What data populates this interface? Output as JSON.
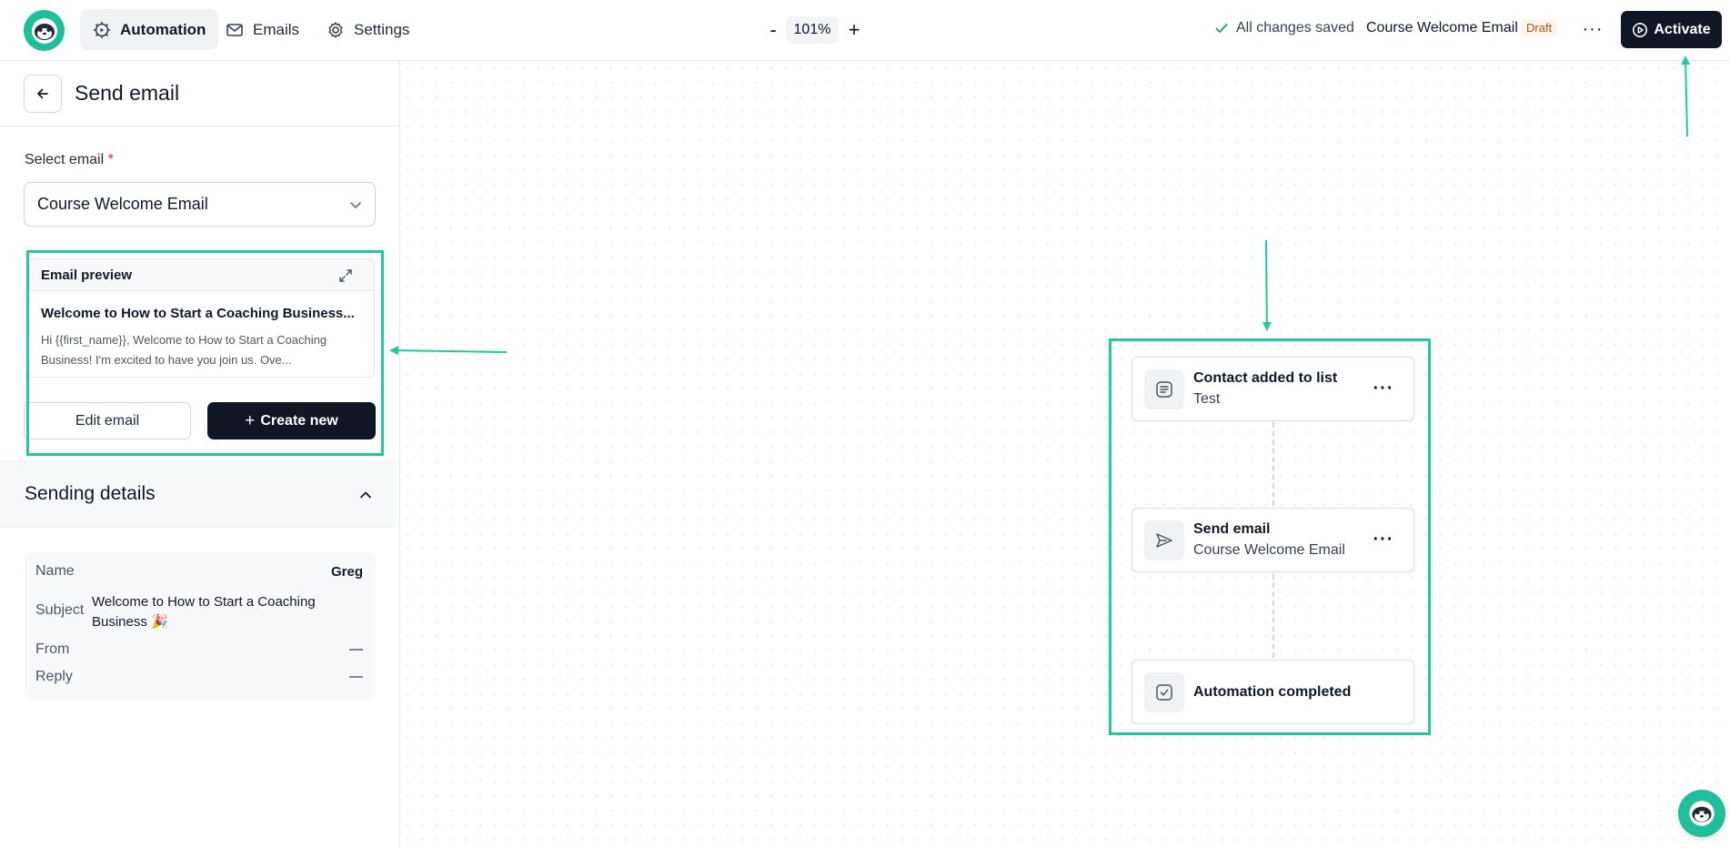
{
  "topbar": {
    "nav": [
      {
        "label": "Automation",
        "icon": "gear-play-icon",
        "active": true
      },
      {
        "label": "Emails",
        "icon": "mail-icon",
        "active": false
      },
      {
        "label": "Settings",
        "icon": "gear-icon",
        "active": false
      }
    ],
    "zoom": {
      "minus": "-",
      "value": "101%",
      "plus": "+"
    },
    "saved_status": "All changes saved",
    "document_title": "Course Welcome Email",
    "status_badge": "Draft",
    "more": "···",
    "activate_label": "Activate"
  },
  "panel": {
    "title": "Send email",
    "select_label": "Select email",
    "required_mark": "*",
    "selected_email": "Course Welcome Email",
    "preview": {
      "heading": "Email preview",
      "subject": "Welcome to How to Start a Coaching Business...",
      "body": "Hi {{first_name}}, Welcome to How to Start a Coaching Business! I'm excited to have you join us. Ove..."
    },
    "edit_label": "Edit email",
    "create_label": "Create new",
    "create_plus": "+",
    "sending": {
      "title": "Sending details",
      "details": [
        {
          "label": "Name",
          "value": "Greg"
        },
        {
          "label": "Subject",
          "value": "Welcome to How to Start a Coaching Business 🎉"
        },
        {
          "label": "From",
          "value": "—"
        },
        {
          "label": "Reply",
          "value": "—"
        }
      ]
    }
  },
  "flow": {
    "nodes": [
      {
        "title": "Contact added to list",
        "subtitle": "Test",
        "icon": "list-icon"
      },
      {
        "title": "Send email",
        "subtitle": "Course Welcome Email",
        "icon": "send-icon"
      },
      {
        "title": "Automation completed",
        "subtitle": "",
        "icon": "check-square-icon"
      }
    ],
    "more": "···"
  },
  "colors": {
    "brand": "#1fbf9c",
    "primary_button": "#0f1624",
    "annotation": "#22c9a0",
    "draft": "#b45309"
  }
}
